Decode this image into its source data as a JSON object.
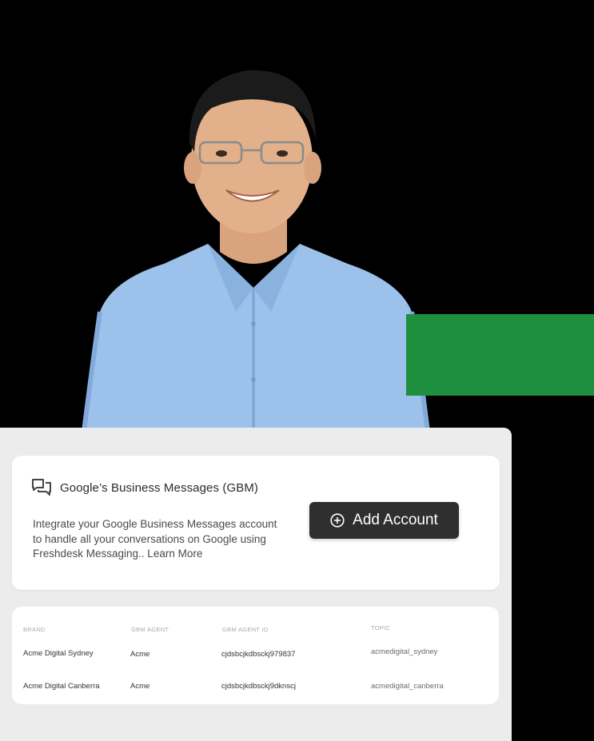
{
  "card": {
    "title": "Google’s Business Messages (GBM)",
    "description": "Integrate your Google Business Messages account to handle all your conversations on Google using Freshdesk Messaging.. Learn More",
    "add_button_label": "Add Account"
  },
  "table": {
    "headers": [
      "BRAND",
      "GBM AGENT",
      "GBM AGENT ID",
      "TOPIC"
    ],
    "rows": [
      [
        "Acme Digital Sydney",
        "Acme",
        "cjdsbcjkdbsckj979837",
        "acmedigital_sydney"
      ],
      [
        "Acme Digital Canberra",
        "Acme",
        "cjdsbcjkdbsckj9dknscj",
        "acmedigital_canberra"
      ]
    ]
  },
  "colors": {
    "background": "#000000",
    "accent_green": "#1e8f3f",
    "button_bg": "#2f2f2f",
    "panel_bg": "#ececec",
    "shirt_blue": "#8fb8e6"
  },
  "icons": {
    "chat": "chat-bubbles-icon",
    "add": "plus-circle-icon"
  }
}
